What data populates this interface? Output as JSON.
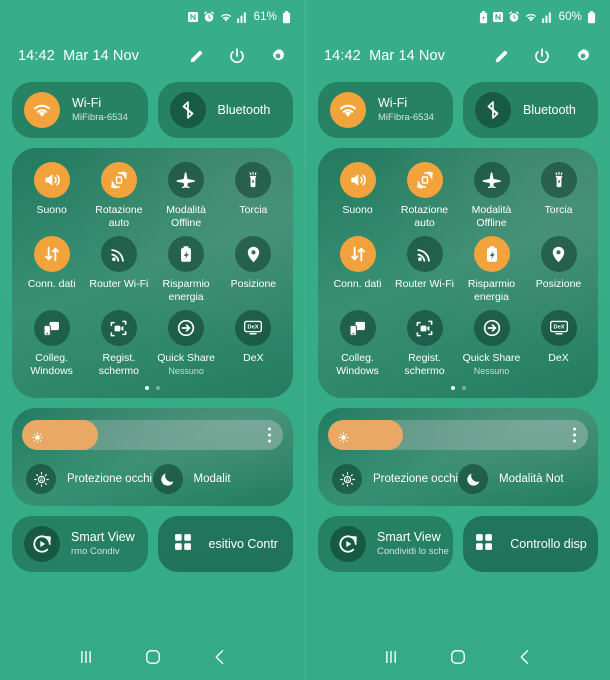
{
  "meta": {
    "accent_on": "#f2a33c",
    "slider_fill": "#e9a964",
    "bg_top": "#38ae88",
    "bg_bottom": "#35ab85",
    "card_bg": "rgba(14,64,48,0.42)"
  },
  "panels": [
    {
      "id": "left",
      "statusbar": {
        "icons": [
          "nfc-icon",
          "alarm-icon",
          "wifi-icon",
          "signal-icon"
        ],
        "battery_percent": "61%",
        "battery_icon": "battery-icon"
      },
      "header": {
        "clock": "14:42",
        "date": "Mar 14 Nov",
        "actions": [
          "pencil-icon",
          "power-icon",
          "gear-icon"
        ]
      },
      "top_toggles": [
        {
          "icon": "wifi-icon",
          "title": "Wi-Fi",
          "subtitle": "MiFibra-6534",
          "active": true
        },
        {
          "icon": "bluetooth-icon",
          "title": "Bluetooth",
          "subtitle": "",
          "active": false
        }
      ],
      "tiles": [
        {
          "icon": "sound-icon",
          "label": "Suono",
          "sub": "",
          "active": true
        },
        {
          "icon": "auto-rotate-icon",
          "label": "Rotazione auto",
          "sub": "",
          "active": true
        },
        {
          "icon": "airplane-icon",
          "label": "Modalità Offline",
          "sub": "",
          "active": false
        },
        {
          "icon": "flashlight-icon",
          "label": "Torcia",
          "sub": "",
          "active": false
        },
        {
          "icon": "mobile-data-icon",
          "label": "Conn. dati",
          "sub": "",
          "active": true
        },
        {
          "icon": "hotspot-icon",
          "label": "Router Wi-Fi",
          "sub": "",
          "active": false
        },
        {
          "icon": "battery-saver-icon",
          "label": "Risparmio energia",
          "sub": "",
          "active": false
        },
        {
          "icon": "location-icon",
          "label": "Posizione",
          "sub": "",
          "active": false
        },
        {
          "icon": "link-windows-icon",
          "label": "Colleg. Windows",
          "sub": "",
          "active": false
        },
        {
          "icon": "screen-record-icon",
          "label": "Regist. schermo",
          "sub": "",
          "active": false
        },
        {
          "icon": "quick-share-icon",
          "label": "Quick Share",
          "sub": "Nessuno",
          "active": false
        },
        {
          "icon": "dex-icon",
          "label": "DeX",
          "sub": "",
          "active": false
        }
      ],
      "page_dots": {
        "count": 2,
        "active_index": 0
      },
      "brightness": {
        "value_percent": 29,
        "icon": "brightness-icon",
        "menu_icon": "more-vertical-icon"
      },
      "brightness_toggles": [
        {
          "icon": "eye-comfort-icon",
          "label": "Protezione occhi",
          "active": false
        },
        {
          "icon": "night-mode-icon",
          "label": "Modalit",
          "active": false
        }
      ],
      "bottom_cards": [
        {
          "icon": "smart-view-icon",
          "title": "Smart View",
          "subtitle": "rmo      Condiv"
        },
        {
          "icon": "device-control-icon",
          "label": "esitivo        Contr"
        }
      ],
      "navbar": [
        "recents-icon",
        "home-icon",
        "back-icon"
      ]
    },
    {
      "id": "right",
      "statusbar": {
        "icons": [
          "power-saving-icon",
          "nfc-icon",
          "alarm-icon",
          "wifi-icon",
          "signal-icon"
        ],
        "battery_percent": "60%",
        "battery_icon": "battery-icon"
      },
      "header": {
        "clock": "14:42",
        "date": "Mar 14 Nov",
        "actions": [
          "pencil-icon",
          "power-icon",
          "gear-icon"
        ]
      },
      "top_toggles": [
        {
          "icon": "wifi-icon",
          "title": "Wi-Fi",
          "subtitle": "MiFibra-6534",
          "active": true
        },
        {
          "icon": "bluetooth-icon",
          "title": "Bluetooth",
          "subtitle": "",
          "active": false
        }
      ],
      "tiles": [
        {
          "icon": "sound-icon",
          "label": "Suono",
          "sub": "",
          "active": true
        },
        {
          "icon": "auto-rotate-icon",
          "label": "Rotazione auto",
          "sub": "",
          "active": true
        },
        {
          "icon": "airplane-icon",
          "label": "Modalità Offline",
          "sub": "",
          "active": false
        },
        {
          "icon": "flashlight-icon",
          "label": "Torcia",
          "sub": "",
          "active": false
        },
        {
          "icon": "mobile-data-icon",
          "label": "Conn. dati",
          "sub": "",
          "active": true
        },
        {
          "icon": "hotspot-icon",
          "label": "Router Wi-Fi",
          "sub": "",
          "active": false
        },
        {
          "icon": "battery-saver-icon",
          "label": "Risparmio energia",
          "sub": "",
          "active": true
        },
        {
          "icon": "location-icon",
          "label": "Posizione",
          "sub": "",
          "active": false
        },
        {
          "icon": "link-windows-icon",
          "label": "Colleg. Windows",
          "sub": "",
          "active": false
        },
        {
          "icon": "screen-record-icon",
          "label": "Regist. schermo",
          "sub": "",
          "active": false
        },
        {
          "icon": "quick-share-icon",
          "label": "Quick Share",
          "sub": "Nessuno",
          "active": false
        },
        {
          "icon": "dex-icon",
          "label": "DeX",
          "sub": "",
          "active": false
        }
      ],
      "page_dots": {
        "count": 2,
        "active_index": 0
      },
      "brightness": {
        "value_percent": 29,
        "icon": "brightness-icon",
        "menu_icon": "more-vertical-icon"
      },
      "brightness_toggles": [
        {
          "icon": "eye-comfort-icon",
          "label": "Protezione occhi",
          "active": false
        },
        {
          "icon": "night-mode-icon",
          "label": "Modalità Not",
          "active": false
        }
      ],
      "bottom_cards": [
        {
          "icon": "smart-view-icon",
          "title": "Smart View",
          "subtitle": "Condividi lo sche"
        },
        {
          "icon": "device-control-icon",
          "label": "Controllo disp"
        }
      ],
      "navbar": [
        "recents-icon",
        "home-icon",
        "back-icon"
      ]
    }
  ]
}
